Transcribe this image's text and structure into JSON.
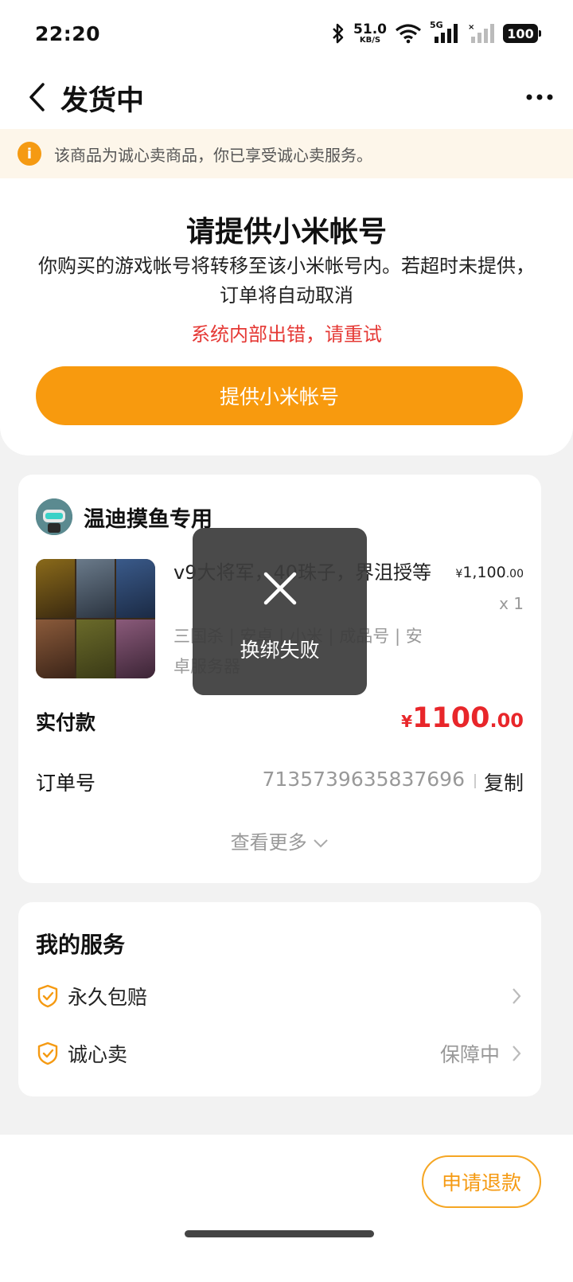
{
  "status_bar": {
    "time": "22:20",
    "net_speed_value": "51.0",
    "net_speed_unit": "KB/S",
    "network_label": "5G",
    "battery": "100"
  },
  "header": {
    "title": "发货中"
  },
  "notice": {
    "text": "该商品为诚心卖商品，你已享受诚心卖服务。"
  },
  "account_request": {
    "title": "请提供小米帐号",
    "description": "你购买的游戏帐号将转移至该小米帐号内。若超时未提供，订单将自动取消",
    "error": "系统内部出错，请重试",
    "button_label": "提供小米帐号"
  },
  "order": {
    "seller_name": "温迪摸鱼专用",
    "product_title": "v9大将军，40珠子，界沮授等",
    "product_tags": "三国杀 | 安卓 | 小米 | 成品号 | 安卓服务器",
    "unit_price_currency": "¥",
    "unit_price_int": "1,100",
    "unit_price_dec": ".00",
    "quantity": "x 1",
    "paid_label": "实付款",
    "paid_currency": "¥",
    "paid_int": "1100",
    "paid_dec": ".00",
    "order_no_label": "订单号",
    "order_no": "7135739635837696",
    "copy_label": "复制",
    "more_label": "查看更多"
  },
  "services": {
    "title": "我的服务",
    "items": [
      {
        "label": "永久包赔",
        "status": ""
      },
      {
        "label": "诚心卖",
        "status": "保障中"
      }
    ]
  },
  "bottom": {
    "refund_label": "申请退款"
  },
  "toast": {
    "text": "换绑失败"
  },
  "colors": {
    "accent": "#f89a0e",
    "error": "#e53935",
    "price": "#e8262a"
  }
}
